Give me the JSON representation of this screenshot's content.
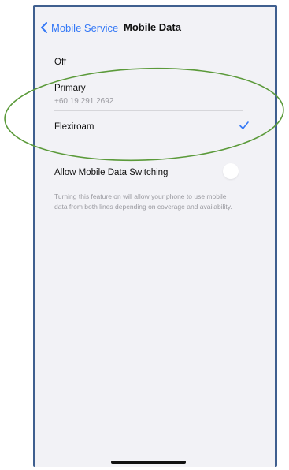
{
  "nav": {
    "back_label": "Mobile Service",
    "title": "Mobile Data"
  },
  "options": {
    "off_label": "Off",
    "primary_label": "Primary",
    "primary_number": "+60 19 291 2692",
    "flexiroam_label": "Flexiroam",
    "selected": "Flexiroam"
  },
  "switching": {
    "label": "Allow Mobile Data Switching",
    "enabled": false,
    "description": "Turning this feature on will allow your phone to use mobile data from both lines depending on coverage and availability."
  },
  "colors": {
    "accent": "#3478f6",
    "annotation_ellipse": "#5b9a3a",
    "frame_border": "#3f5f8f"
  },
  "icons": {
    "back": "chevron-left-icon",
    "selected": "checkmark-icon"
  }
}
